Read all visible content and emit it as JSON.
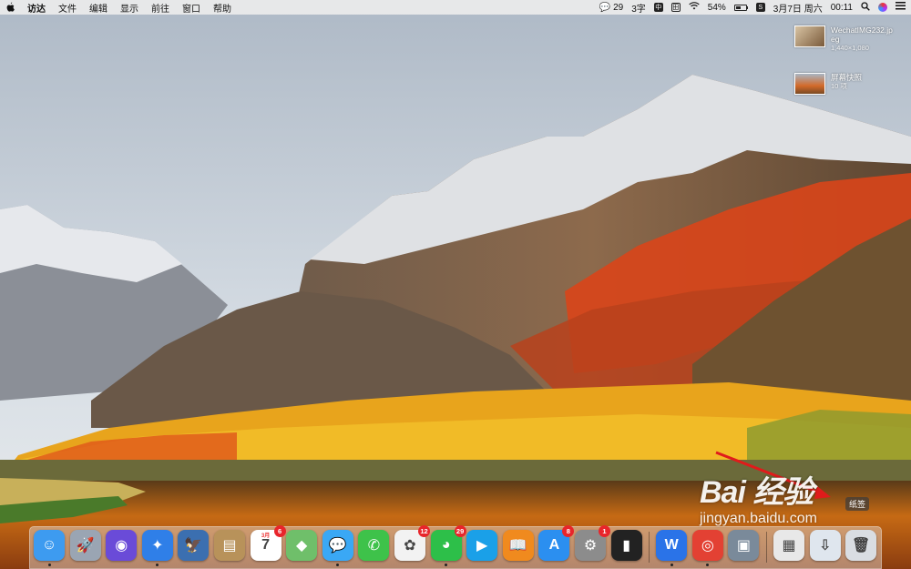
{
  "menubar": {
    "app_menus": [
      "访达",
      "文件",
      "编辑",
      "显示",
      "前往",
      "窗口",
      "帮助"
    ],
    "wechat_count": "29",
    "input_method": "3字",
    "input_icon_a": "中",
    "input_icon_b": "田",
    "battery_percent": "54%",
    "battery_level": 0.54,
    "status_s": "S",
    "date": "3月7日 周六",
    "time": "00:11"
  },
  "desktop_items": [
    {
      "name": "WechatIMG232.jp",
      "name2": "eg",
      "meta": "1,440×1,080"
    },
    {
      "name": "屏幕快照",
      "meta": "10 项"
    }
  ],
  "dock": {
    "apps": [
      {
        "icon": "finder-icon",
        "glyph": "☺",
        "color": "#3d9bf0",
        "running": true
      },
      {
        "icon": "launchpad-icon",
        "glyph": "🚀",
        "color": "#9aa5b3"
      },
      {
        "icon": "siri-icon",
        "glyph": "◉",
        "color": "#6a4bd8"
      },
      {
        "icon": "safari-icon",
        "glyph": "✦",
        "color": "#2f7fe8",
        "running": true
      },
      {
        "icon": "photo-viewer-icon",
        "glyph": "🦅",
        "color": "#3b6fb0"
      },
      {
        "icon": "contacts-icon",
        "glyph": "▤",
        "color": "#b8925a"
      },
      {
        "icon": "calendar-icon",
        "glyph": "7",
        "color": "#ffffff",
        "badge": "6",
        "label_top": "3月"
      },
      {
        "icon": "maps-icon",
        "glyph": "◆",
        "color": "#6fbf6a"
      },
      {
        "icon": "messages-icon",
        "glyph": "💬",
        "color": "#3aa8f5",
        "running": true
      },
      {
        "icon": "facetime-icon",
        "glyph": "✆",
        "color": "#3ec24a"
      },
      {
        "icon": "photos-icon",
        "glyph": "✿",
        "color": "#f2f2f2",
        "badge": "12"
      },
      {
        "icon": "wechat-icon",
        "glyph": "◕",
        "color": "#2dbf49",
        "badge": "29",
        "running": true
      },
      {
        "icon": "video-player-icon",
        "glyph": "▶",
        "color": "#1aa0e8"
      },
      {
        "icon": "books-icon",
        "glyph": "📖",
        "color": "#f08a1e"
      },
      {
        "icon": "app-store-icon",
        "glyph": "A",
        "color": "#2b8ff0",
        "badge": "8"
      },
      {
        "icon": "system-preferences-icon",
        "glyph": "⚙",
        "color": "#8c8c8c",
        "badge": "1"
      },
      {
        "icon": "terminal-icon",
        "glyph": "▮",
        "color": "#222222"
      },
      {
        "icon": "wps-icon",
        "glyph": "W",
        "color": "#2a73e8",
        "running": true
      },
      {
        "icon": "chrome-icon",
        "glyph": "◎",
        "color": "#e34133",
        "running": true
      },
      {
        "icon": "preview-icon",
        "glyph": "▣",
        "color": "#7a8a9a"
      },
      {
        "icon": "stickies-icon",
        "glyph": "▦",
        "color": "#e8e8e8"
      },
      {
        "icon": "downloads-folder-icon",
        "glyph": "⇩",
        "color": "#dfe6ee"
      },
      {
        "icon": "trash-icon",
        "glyph": "🗑",
        "color": "#d9dde2"
      }
    ]
  },
  "watermark": {
    "logo": "Bai 经验",
    "url": "jingyan.baidu.com"
  },
  "tooltip": "纸签",
  "colors": {
    "menubar_bg": "#ececec",
    "badge": "#e8252b",
    "arrow": "#e01b1b"
  }
}
